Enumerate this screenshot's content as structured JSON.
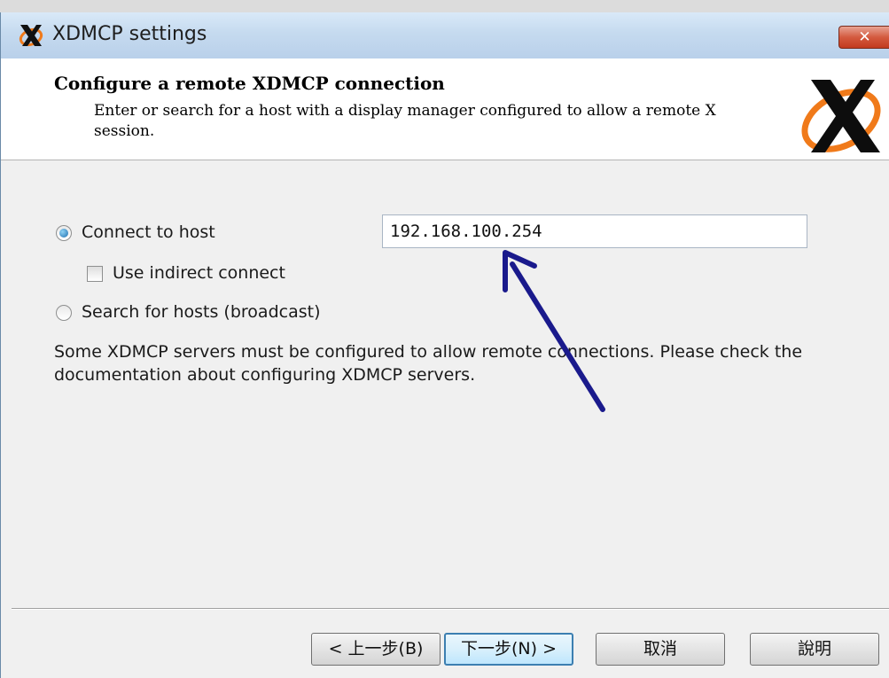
{
  "window": {
    "title": "XDMCP settings",
    "close_label": "✕"
  },
  "header": {
    "title": "Configure a remote XDMCP connection",
    "description": "Enter or search for a host with a display manager configured to allow a remote X session."
  },
  "options": {
    "connect_to_host": {
      "label": "Connect to host",
      "checked": true
    },
    "use_indirect": {
      "label": "Use indirect connect",
      "checked": false
    },
    "search_hosts": {
      "label": "Search for hosts (broadcast)",
      "checked": false
    }
  },
  "host_input": {
    "value": "192.168.100.254"
  },
  "info_text": "Some XDMCP servers must be configured to allow remote connections. Please check the documentation about configuring XDMCP servers.",
  "buttons": {
    "back": "< 上一步(B)",
    "next": "下一步(N) >",
    "cancel": "取消",
    "help": "說明"
  },
  "colors": {
    "annotation_arrow": "#1a1a8c",
    "titlebar": "#c5daef",
    "logo_orange": "#f07a1a"
  },
  "icons": [
    "x-logo-icon",
    "close-icon",
    "radio-checked",
    "checkbox-unchecked",
    "arrow-annotation"
  ]
}
